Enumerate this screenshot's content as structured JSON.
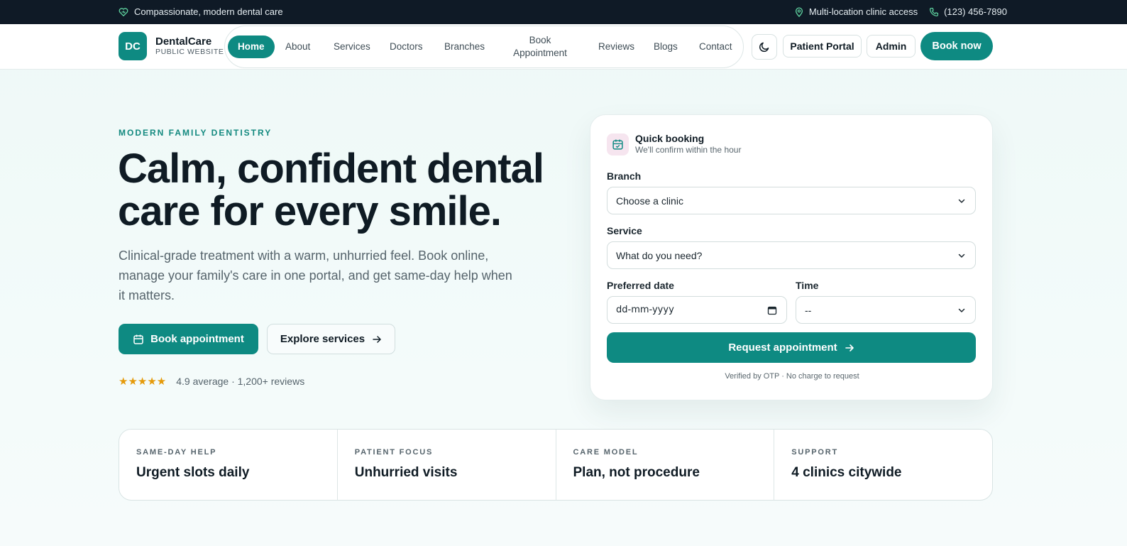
{
  "topbar": {
    "tagline": "Compassionate, modern dental care",
    "locations": "Multi-location clinic access",
    "phone": "(123) 456-7890",
    "icons": [
      "heart-icon",
      "map-pin-icon",
      "phone-icon"
    ]
  },
  "header": {
    "logo_badge": "DC",
    "brand": "DentalCare",
    "brand_sub": "PUBLIC WEBSITE",
    "nav": {
      "home": "Home",
      "about": "About",
      "services": "Services",
      "doctors": "Doctors",
      "branches": "Branches",
      "book_line1": "Book",
      "book_line2": "Appointment",
      "reviews": "Reviews",
      "blogs": "Blogs",
      "contact": "Contact"
    },
    "theme_icon": "moon-icon",
    "patient_portal": "Patient Portal",
    "admin": "Admin",
    "book_now": "Book now"
  },
  "hero": {
    "eyebrow": "MODERN FAMILY DENTISTRY",
    "title": "Calm, confident dental care for every smile.",
    "subtitle": "Clinical-grade treatment with a warm, unhurried feel. Book online, manage your family's care in one portal, and get same-day help when it matters.",
    "primary_button": "Book appointment",
    "secondary_button": "Explore services",
    "stars": "★★★★★",
    "rating_text": "4.9 average · 1,200+ reviews"
  },
  "booking": {
    "title": "Quick booking",
    "subtitle": "We'll confirm within the hour",
    "branch_label": "Branch",
    "branch_value": "Choose a clinic",
    "service_label": "Service",
    "service_value": "What do you need?",
    "date_label": "Preferred date",
    "date_value": "dd-mm-yyyy",
    "time_label": "Time",
    "time_value": "--",
    "submit": "Request appointment",
    "footnote": "Verified by OTP · No charge to request"
  },
  "stats": [
    {
      "label": "SAME-DAY HELP",
      "value": "Urgent slots daily"
    },
    {
      "label": "PATIENT FOCUS",
      "value": "Unhurried visits"
    },
    {
      "label": "CARE MODEL",
      "value": "Plan, not procedure"
    },
    {
      "label": "SUPPORT",
      "value": "4 clinics citywide"
    }
  ],
  "colors": {
    "accent": "#0e8a82",
    "topbar": "#0f1a26",
    "star": "#e59a0a"
  }
}
